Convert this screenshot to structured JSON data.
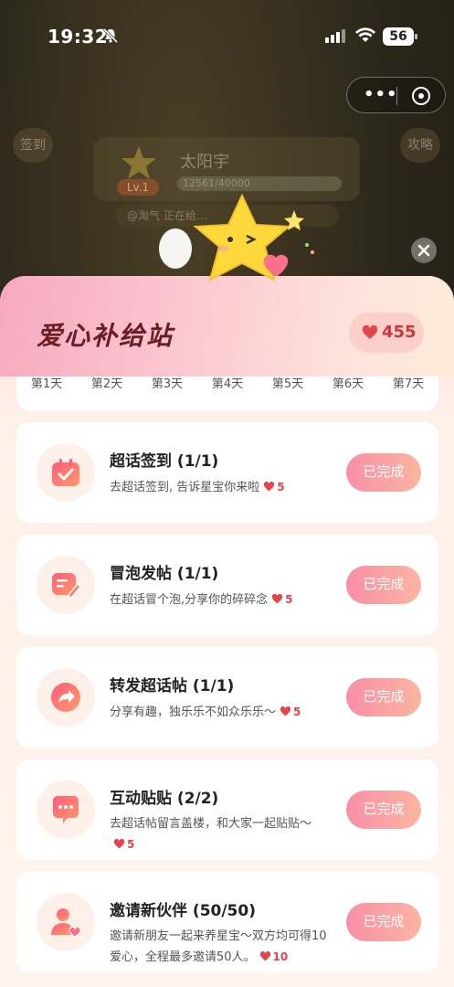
{
  "status_bar": {
    "time": "19:32",
    "battery": "56"
  },
  "background": {
    "left_button": "签到",
    "right_button": "攻略",
    "name": "太阳宇",
    "level": "Lv.1",
    "progress_text": "12561/40000",
    "ticker": "@淘气 正在给…"
  },
  "sheet": {
    "title": "爱心补给站",
    "heart_count": "455"
  },
  "days": [
    "第1天",
    "第2天",
    "第3天",
    "第4天",
    "第5天",
    "第6天",
    "第7天"
  ],
  "tasks": [
    {
      "title": "超话签到 (1/1)",
      "desc": "去超话签到, 告诉星宝你来啦",
      "reward": "5",
      "button": "已完成",
      "icon": "calendar-check-icon"
    },
    {
      "title": "冒泡发帖 (1/1)",
      "desc": "在超话冒个泡,分享你的碎碎念",
      "reward": "5",
      "button": "已完成",
      "icon": "post-edit-icon"
    },
    {
      "title": "转发超话帖 (1/1)",
      "desc": "分享有趣，独乐乐不如众乐乐～",
      "reward": "5",
      "button": "已完成",
      "icon": "share-arrow-icon"
    },
    {
      "title": "互动贴贴 (2/2)",
      "desc": "去超话帖留言盖楼，和大家一起贴贴～",
      "reward": "5",
      "button": "已完成",
      "icon": "chat-bubble-icon"
    },
    {
      "title": "邀请新伙伴 (50/50)",
      "desc": "邀请新朋友一起来养星宝～双方均可得10爱心，全程最多邀请50人。",
      "reward": "10",
      "button": "已完成",
      "icon": "invite-user-icon"
    }
  ],
  "colors": {
    "accent": "#f98fa8",
    "heart": "#e5444a",
    "title": "#6a1d24"
  }
}
